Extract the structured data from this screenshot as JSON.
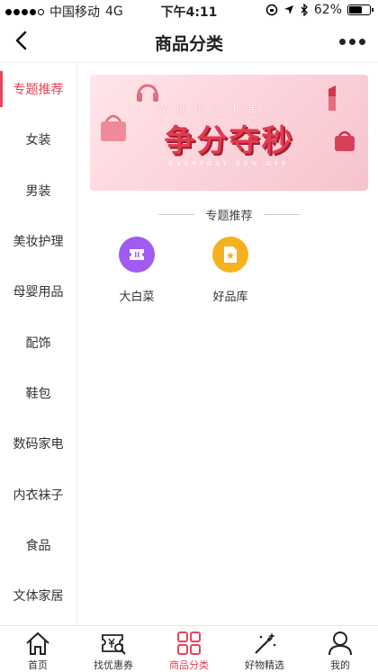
{
  "status_bar": {
    "carrier": "中国移动",
    "network": "4G",
    "time": "下午4:11",
    "battery": "62%",
    "battery_level": 0.62
  },
  "navbar": {
    "title": "商品分类",
    "back_icon": "chevron-left-icon",
    "more_icon": "more-dots-icon"
  },
  "sidebar": {
    "items": [
      {
        "label": "专题推荐",
        "active": true
      },
      {
        "label": "女装"
      },
      {
        "label": "男装"
      },
      {
        "label": "美妆护理"
      },
      {
        "label": "母婴用品"
      },
      {
        "label": "配饰"
      },
      {
        "label": "鞋包"
      },
      {
        "label": "数码家电"
      },
      {
        "label": "内衣袜子"
      },
      {
        "label": "食品"
      },
      {
        "label": "文体家居"
      }
    ]
  },
  "banner": {
    "top_text": "好货错过不再",
    "main_text": "争分夺秒",
    "sub_text": "EVERYDAY 50% OFF"
  },
  "section": {
    "title": "专题推荐"
  },
  "categories": [
    {
      "label": "大白菜",
      "icon": "ticket-icon",
      "color": "#a25bf0"
    },
    {
      "label": "好品库",
      "icon": "star-document-icon",
      "color": "#f5b21f"
    }
  ],
  "tabbar": {
    "items": [
      {
        "label": "首页",
        "icon": "home-icon"
      },
      {
        "label": "找优惠券",
        "icon": "coupon-search-icon"
      },
      {
        "label": "商品分类",
        "icon": "grid-icon",
        "active": true
      },
      {
        "label": "好物精选",
        "icon": "magic-wand-icon"
      },
      {
        "label": "我的",
        "icon": "user-icon"
      }
    ]
  },
  "colors": {
    "accent": "#e8435a"
  }
}
